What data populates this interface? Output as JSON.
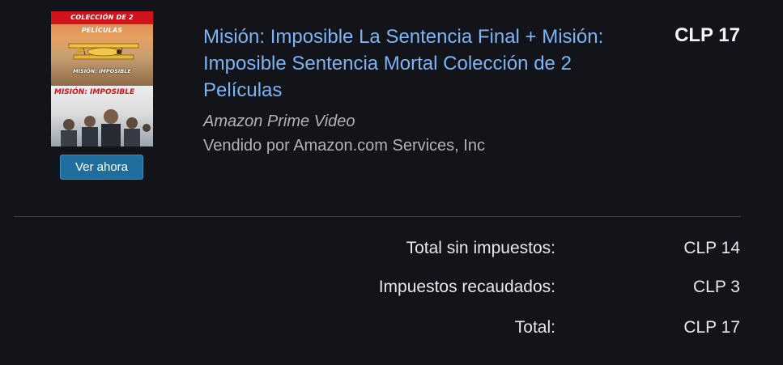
{
  "product": {
    "cover": {
      "banner": "COLECCIÓN DE 2 PELÍCULAS",
      "subtitle_top": "MISIÓN: IMPOSIBLE",
      "subtitle_bottom": "MISIÓN: IMPOSIBLE"
    },
    "watch_label": "Ver ahora",
    "title": "Misión: Imposible La Sentencia Final + Misión: Imposible Sentencia Mortal Colección de 2 Películas",
    "price": "CLP 17",
    "publisher": "Amazon Prime Video",
    "seller": "Vendido por Amazon.com Services, Inc"
  },
  "summary": {
    "rows": [
      {
        "label": "Total sin impuestos:",
        "value": "CLP 14"
      },
      {
        "label": "Impuestos recaudados:",
        "value": "CLP 3"
      },
      {
        "label": "Total:",
        "value": "CLP 17"
      }
    ]
  },
  "colors": {
    "background": "#131419",
    "link": "#7cb4f4",
    "button": "#1f6e9d",
    "muted_text": "#b3b3b3"
  }
}
